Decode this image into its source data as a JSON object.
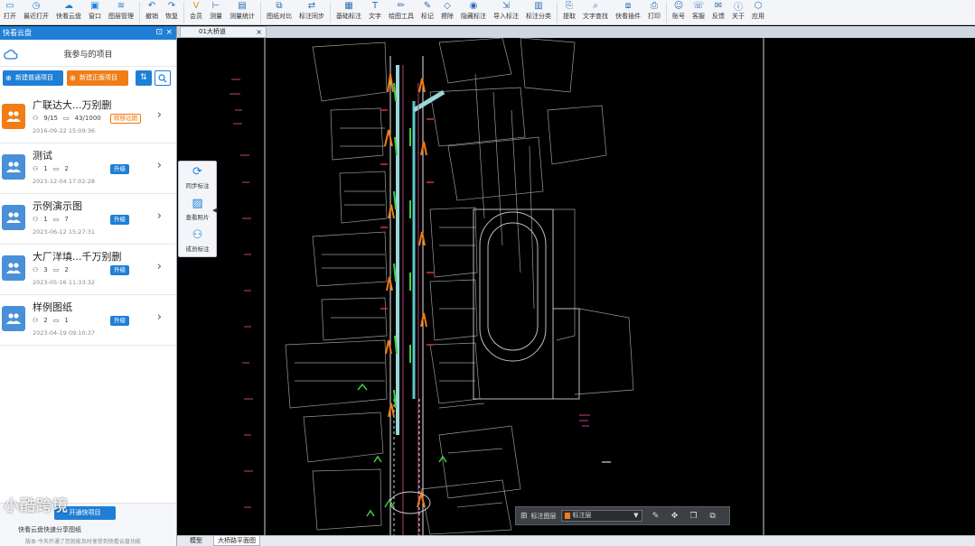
{
  "toolbar": {
    "items": [
      {
        "label": "打开",
        "icon": "folder-icon"
      },
      {
        "label": "最近打开",
        "icon": "history-icon"
      },
      {
        "label": "快看云盘",
        "icon": "cloud-icon"
      },
      {
        "label": "窗口",
        "icon": "window-icon"
      },
      {
        "label": "图层管理",
        "icon": "layers-icon"
      },
      {
        "label": "撤销",
        "icon": "undo-icon"
      },
      {
        "label": "恢复",
        "icon": "redo-icon"
      },
      {
        "label": "会员",
        "icon": "vip-icon"
      },
      {
        "label": "测量",
        "icon": "measure-icon"
      },
      {
        "label": "测量统计",
        "icon": "measure-stats-icon"
      },
      {
        "label": "图纸对比",
        "icon": "compare-icon"
      },
      {
        "label": "标注同步",
        "icon": "sync-annotation-icon"
      },
      {
        "label": "基础标注",
        "icon": "basic-annotation-icon"
      },
      {
        "label": "文字",
        "icon": "text-icon"
      },
      {
        "label": "绘图工具",
        "icon": "draw-tools-icon"
      },
      {
        "label": "标记",
        "icon": "mark-icon"
      },
      {
        "label": "擦除",
        "icon": "eraser-icon"
      },
      {
        "label": "隐藏标注",
        "icon": "hide-annotation-icon"
      },
      {
        "label": "导入标注",
        "icon": "import-annotation-icon"
      },
      {
        "label": "标注分类",
        "icon": "annotation-category-icon"
      },
      {
        "label": "提取",
        "icon": "extract-icon"
      },
      {
        "label": "文字查找",
        "icon": "text-search-icon"
      },
      {
        "label": "快看插件",
        "icon": "plugin-icon"
      },
      {
        "label": "打印",
        "icon": "print-icon"
      },
      {
        "label": "账号",
        "icon": "account-icon"
      },
      {
        "label": "客服",
        "icon": "support-icon"
      },
      {
        "label": "反馈",
        "icon": "feedback-icon"
      },
      {
        "label": "关于",
        "icon": "info-icon"
      },
      {
        "label": "应用",
        "icon": "apps-icon"
      }
    ]
  },
  "panel": {
    "title": "快看云盘",
    "heading": "我参与的项目",
    "new_project": "新建普通项目",
    "new_formal_project": "新建正版项目",
    "exit_button": "开通快项目",
    "footer_note1": "快看云盘快速分享图纸",
    "footer_note2": "版本·今天开通了您就能及时享受到快看云盘功能"
  },
  "projects": [
    {
      "name": "广联达大...万别删",
      "members": "9/15",
      "storage": "43/1000",
      "date": "2016-09-22 15:09:36",
      "tag": "转移过期",
      "tag_style": "orange",
      "avatar_color": "#f07d16"
    },
    {
      "name": "测试",
      "members": "1",
      "storage": "2",
      "date": "2023-12-04 17:02:28",
      "tag": "升级",
      "tag_style": "blue",
      "avatar_color": "#4a90d9"
    },
    {
      "name": "示例演示图",
      "members": "1",
      "storage": "7",
      "date": "2023-06-12 15:27:31",
      "tag": "升级",
      "tag_style": "blue",
      "avatar_color": "#4a90d9"
    },
    {
      "name": "大厂洋填...千万别删",
      "members": "3",
      "storage": "2",
      "date": "2023-05-16 11:33:32",
      "tag": "升级",
      "tag_style": "blue",
      "avatar_color": "#4a90d9"
    },
    {
      "name": "样例图纸",
      "members": "2",
      "storage": "1",
      "date": "2023-04-19 09:10:37",
      "tag": "升级",
      "tag_style": "blue",
      "avatar_color": "#4a90d9"
    }
  ],
  "doc_tab": {
    "label": "01大桥道"
  },
  "mini_toolbar": {
    "items": [
      {
        "label": "同步标注",
        "icon": "sync-icon"
      },
      {
        "label": "查看照片",
        "icon": "photo-icon"
      },
      {
        "label": "成员标注",
        "icon": "members-icon"
      }
    ]
  },
  "layer_bar": {
    "label": "标注图层",
    "selected": "标注层"
  },
  "bottom_tabs": [
    {
      "label": "模型",
      "active": false
    },
    {
      "label": "大桥路平面图",
      "active": true
    }
  ],
  "watermark": "小酷跨境",
  "colors": {
    "accent": "#1f7fd6",
    "orange": "#f07d16"
  }
}
